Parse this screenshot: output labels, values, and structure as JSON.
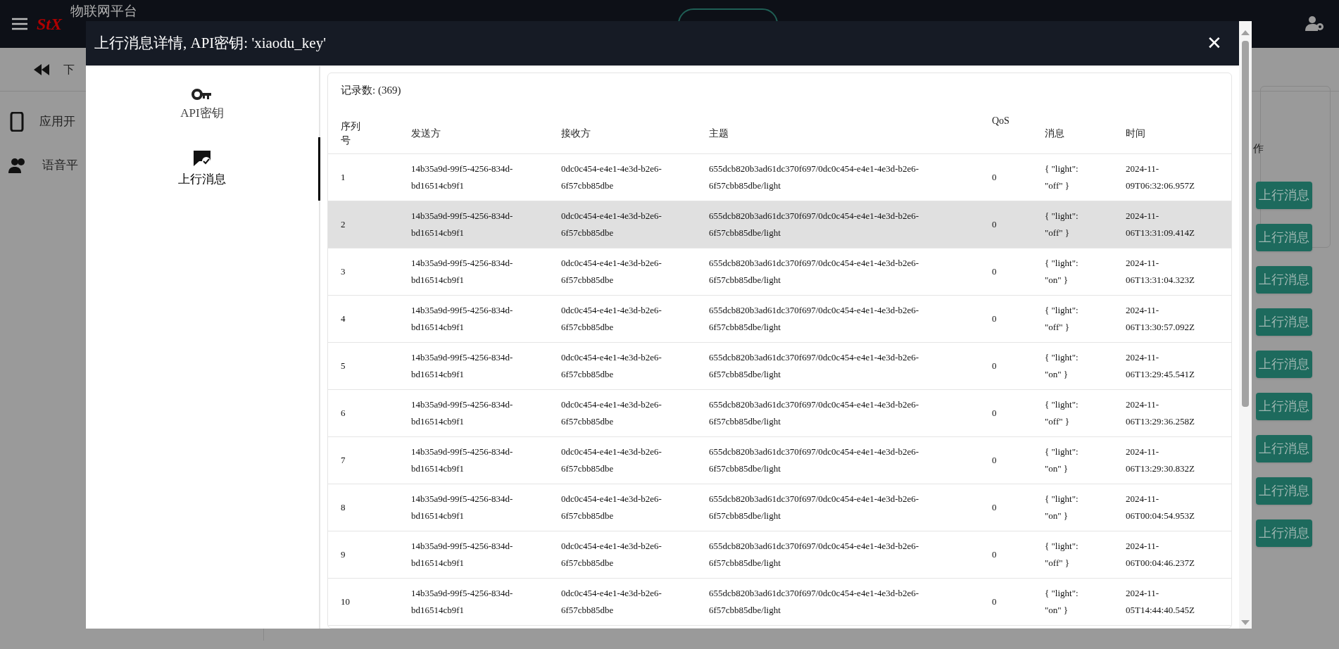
{
  "page": {
    "logo": "StX",
    "title": "物联网平台",
    "toolbar_label": "下",
    "sidebar": [
      {
        "label": "应用开"
      },
      {
        "label": "语音平"
      }
    ],
    "column_label": "作",
    "row_buttons": [
      "上行消息",
      "上行消息",
      "上行消息",
      "上行消息",
      "上行消息",
      "上行消息",
      "上行消息",
      "上行消息",
      "上行消息"
    ]
  },
  "dialog": {
    "title": "上行消息详情, API密钥: 'xiaodu_key'",
    "close": "✕",
    "nav": [
      {
        "kind": "key",
        "label": "API密钥",
        "selected": false
      },
      {
        "kind": "message",
        "label": "上行消息",
        "selected": true
      }
    ],
    "record_count": "记录数: (369)",
    "table": {
      "columns": [
        "序列号",
        "发送方",
        "接收方",
        "主题",
        "QoS",
        "消息",
        "时间"
      ],
      "rows": [
        {
          "cells": [
            "1",
            "14b35a9d-99f5-4256-834d-bd16514cb9f1",
            "0dc0c454-e4e1-4e3d-b2e6-6f57cbb85dbe",
            "655dcb820b3ad61dc370f697/0dc0c454-e4e1-4e3d-b2e6-6f57cbb85dbe/light",
            "0",
            "{ \"light\": \"off\" }",
            "2024-11-09T06:32:06.957Z"
          ],
          "highlighted": false
        },
        {
          "cells": [
            "2",
            "14b35a9d-99f5-4256-834d-bd16514cb9f1",
            "0dc0c454-e4e1-4e3d-b2e6-6f57cbb85dbe",
            "655dcb820b3ad61dc370f697/0dc0c454-e4e1-4e3d-b2e6-6f57cbb85dbe/light",
            "0",
            "{ \"light\": \"off\" }",
            "2024-11-06T13:31:09.414Z"
          ],
          "highlighted": true
        },
        {
          "cells": [
            "3",
            "14b35a9d-99f5-4256-834d-bd16514cb9f1",
            "0dc0c454-e4e1-4e3d-b2e6-6f57cbb85dbe",
            "655dcb820b3ad61dc370f697/0dc0c454-e4e1-4e3d-b2e6-6f57cbb85dbe/light",
            "0",
            "{ \"light\": \"on\" }",
            "2024-11-06T13:31:04.323Z"
          ],
          "highlighted": false
        },
        {
          "cells": [
            "4",
            "14b35a9d-99f5-4256-834d-bd16514cb9f1",
            "0dc0c454-e4e1-4e3d-b2e6-6f57cbb85dbe",
            "655dcb820b3ad61dc370f697/0dc0c454-e4e1-4e3d-b2e6-6f57cbb85dbe/light",
            "0",
            "{ \"light\": \"off\" }",
            "2024-11-06T13:30:57.092Z"
          ],
          "highlighted": false
        },
        {
          "cells": [
            "5",
            "14b35a9d-99f5-4256-834d-bd16514cb9f1",
            "0dc0c454-e4e1-4e3d-b2e6-6f57cbb85dbe",
            "655dcb820b3ad61dc370f697/0dc0c454-e4e1-4e3d-b2e6-6f57cbb85dbe/light",
            "0",
            "{ \"light\": \"on\" }",
            "2024-11-06T13:29:45.541Z"
          ],
          "highlighted": false
        },
        {
          "cells": [
            "6",
            "14b35a9d-99f5-4256-834d-bd16514cb9f1",
            "0dc0c454-e4e1-4e3d-b2e6-6f57cbb85dbe",
            "655dcb820b3ad61dc370f697/0dc0c454-e4e1-4e3d-b2e6-6f57cbb85dbe/light",
            "0",
            "{ \"light\": \"off\" }",
            "2024-11-06T13:29:36.258Z"
          ],
          "highlighted": false
        },
        {
          "cells": [
            "7",
            "14b35a9d-99f5-4256-834d-bd16514cb9f1",
            "0dc0c454-e4e1-4e3d-b2e6-6f57cbb85dbe",
            "655dcb820b3ad61dc370f697/0dc0c454-e4e1-4e3d-b2e6-6f57cbb85dbe/light",
            "0",
            "{ \"light\": \"on\" }",
            "2024-11-06T13:29:30.832Z"
          ],
          "highlighted": false
        },
        {
          "cells": [
            "8",
            "14b35a9d-99f5-4256-834d-bd16514cb9f1",
            "0dc0c454-e4e1-4e3d-b2e6-6f57cbb85dbe",
            "655dcb820b3ad61dc370f697/0dc0c454-e4e1-4e3d-b2e6-6f57cbb85dbe/light",
            "0",
            "{ \"light\": \"on\" }",
            "2024-11-06T00:04:54.953Z"
          ],
          "highlighted": false
        },
        {
          "cells": [
            "9",
            "14b35a9d-99f5-4256-834d-bd16514cb9f1",
            "0dc0c454-e4e1-4e3d-b2e6-6f57cbb85dbe",
            "655dcb820b3ad61dc370f697/0dc0c454-e4e1-4e3d-b2e6-6f57cbb85dbe/light",
            "0",
            "{ \"light\": \"off\" }",
            "2024-11-06T00:04:46.237Z"
          ],
          "highlighted": false
        },
        {
          "cells": [
            "10",
            "14b35a9d-99f5-4256-834d-bd16514cb9f1",
            "0dc0c454-e4e1-4e3d-b2e6-6f57cbb85dbe",
            "655dcb820b3ad61dc370f697/0dc0c454-e4e1-4e3d-b2e6-6f57cbb85dbe/light",
            "0",
            "{ \"light\": \"on\" }",
            "2024-11-05T14:44:40.545Z"
          ],
          "highlighted": false
        }
      ]
    }
  }
}
